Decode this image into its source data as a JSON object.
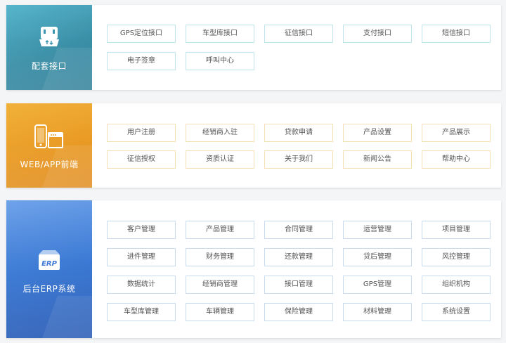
{
  "sections": [
    {
      "title": "配套接口",
      "icon": "plug-connector-icon",
      "accent": "#3e97ae",
      "border": "#bfe6ef",
      "items": [
        "GPS定位接口",
        "车型库接口",
        "征信接口",
        "支付接口",
        "短信接口",
        "电子签章",
        "呼叫中心"
      ]
    },
    {
      "title": "WEB/APP前端",
      "icon": "phone-and-web-icon",
      "accent": "#e99a25",
      "border": "#f6dfb4",
      "items": [
        "用户注册",
        "经销商入驻",
        "贷款申请",
        "产品设置",
        "产品展示",
        "征信授权",
        "资质认证",
        "关于我们",
        "新闻公告",
        "帮助中心"
      ]
    },
    {
      "title": "后台ERP系统",
      "icon": "erp-badge-icon",
      "icon_text": "ERP",
      "accent": "#3b79d4",
      "border": "#c9dbf0",
      "items": [
        "客户管理",
        "产品管理",
        "合同管理",
        "运营管理",
        "项目管理",
        "进件管理",
        "财务管理",
        "还款管理",
        "贷后管理",
        "风控管理",
        "数据统计",
        "经销商管理",
        "接口管理",
        "GPS管理",
        "组织机构",
        "车型库管理",
        "车辆管理",
        "保险管理",
        "材料管理",
        "系统设置"
      ]
    }
  ]
}
